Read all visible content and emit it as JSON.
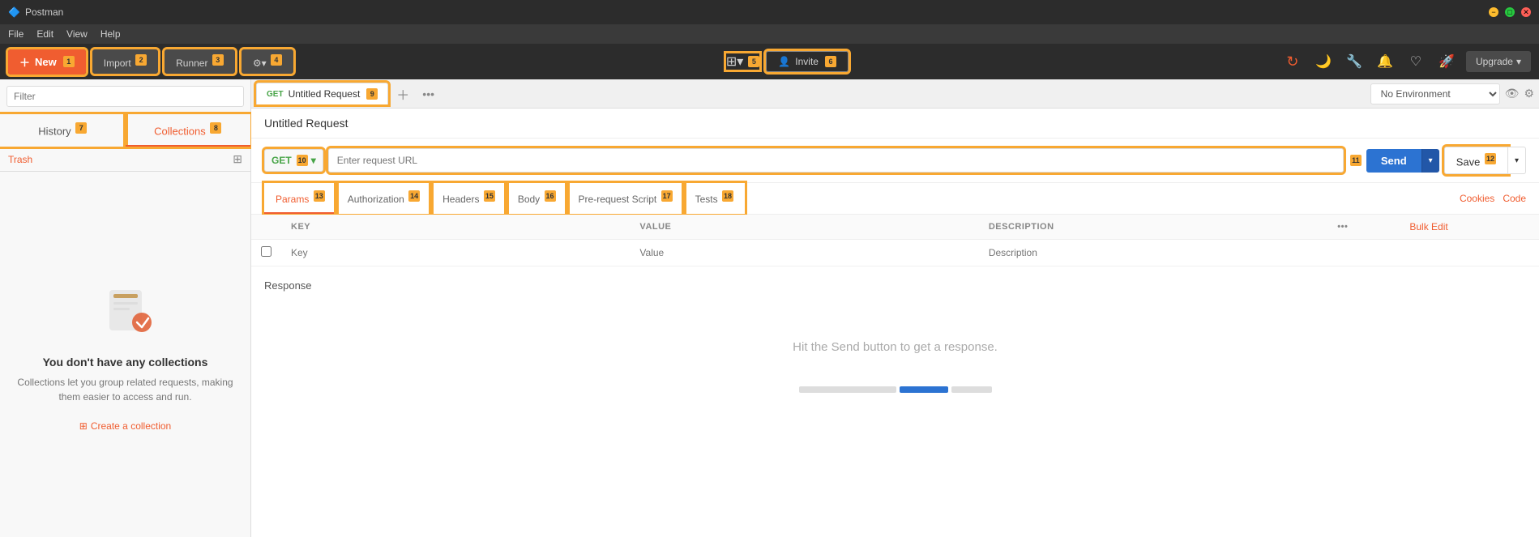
{
  "app": {
    "title": "Postman",
    "icon": "🔷"
  },
  "titlebar": {
    "minimize": "−",
    "maximize": "□",
    "close": "✕"
  },
  "menubar": {
    "items": [
      "File",
      "Edit",
      "View",
      "Help"
    ]
  },
  "toolbar": {
    "new_label": "New",
    "new_badge": "1",
    "import_label": "Import",
    "import_badge": "2",
    "runner_label": "Runner",
    "runner_badge": "3",
    "builder_badge": "4",
    "grid_badge": "5",
    "invite_label": "Invite",
    "invite_badge": "6",
    "upgrade_label": "Upgrade"
  },
  "sidebar": {
    "search_placeholder": "Filter",
    "tab_history": "History",
    "tab_history_badge": "7",
    "tab_collections": "Collections",
    "tab_collections_badge": "8",
    "trash_label": "Trash",
    "no_collections_title": "You don't have any collections",
    "no_collections_desc": "Collections let you group related requests, making them easier to access and run.",
    "create_collection_label": "Create a collection"
  },
  "tabs": {
    "request_tab_method": "GET",
    "request_tab_name": "Untitled Request",
    "request_tab_badge": "9"
  },
  "env": {
    "label": "No Environment"
  },
  "request": {
    "title": "Untitled Request",
    "method": "GET",
    "method_badge": "10",
    "url_placeholder": "Enter request URL",
    "url_badge": "11",
    "send_label": "Send",
    "save_label": "Save",
    "save_badge": "12",
    "subtabs": [
      {
        "label": "Params",
        "badge": "13",
        "active": true
      },
      {
        "label": "Authorization",
        "badge": "14",
        "active": false
      },
      {
        "label": "Headers",
        "badge": "15",
        "active": false
      },
      {
        "label": "Body",
        "badge": "16",
        "active": false
      },
      {
        "label": "Pre-request Script",
        "badge": "17",
        "active": false
      },
      {
        "label": "Tests",
        "badge": "18",
        "active": false
      }
    ],
    "cookies_label": "Cookies",
    "code_label": "Code",
    "bulk_edit_label": "Bulk Edit",
    "params_table": {
      "headers": [
        "KEY",
        "VALUE",
        "DESCRIPTION"
      ],
      "row_key_placeholder": "Key",
      "row_value_placeholder": "Value",
      "row_desc_placeholder": "Description"
    }
  },
  "response": {
    "label": "Response",
    "hint": "Hit the Send button to get a response."
  }
}
